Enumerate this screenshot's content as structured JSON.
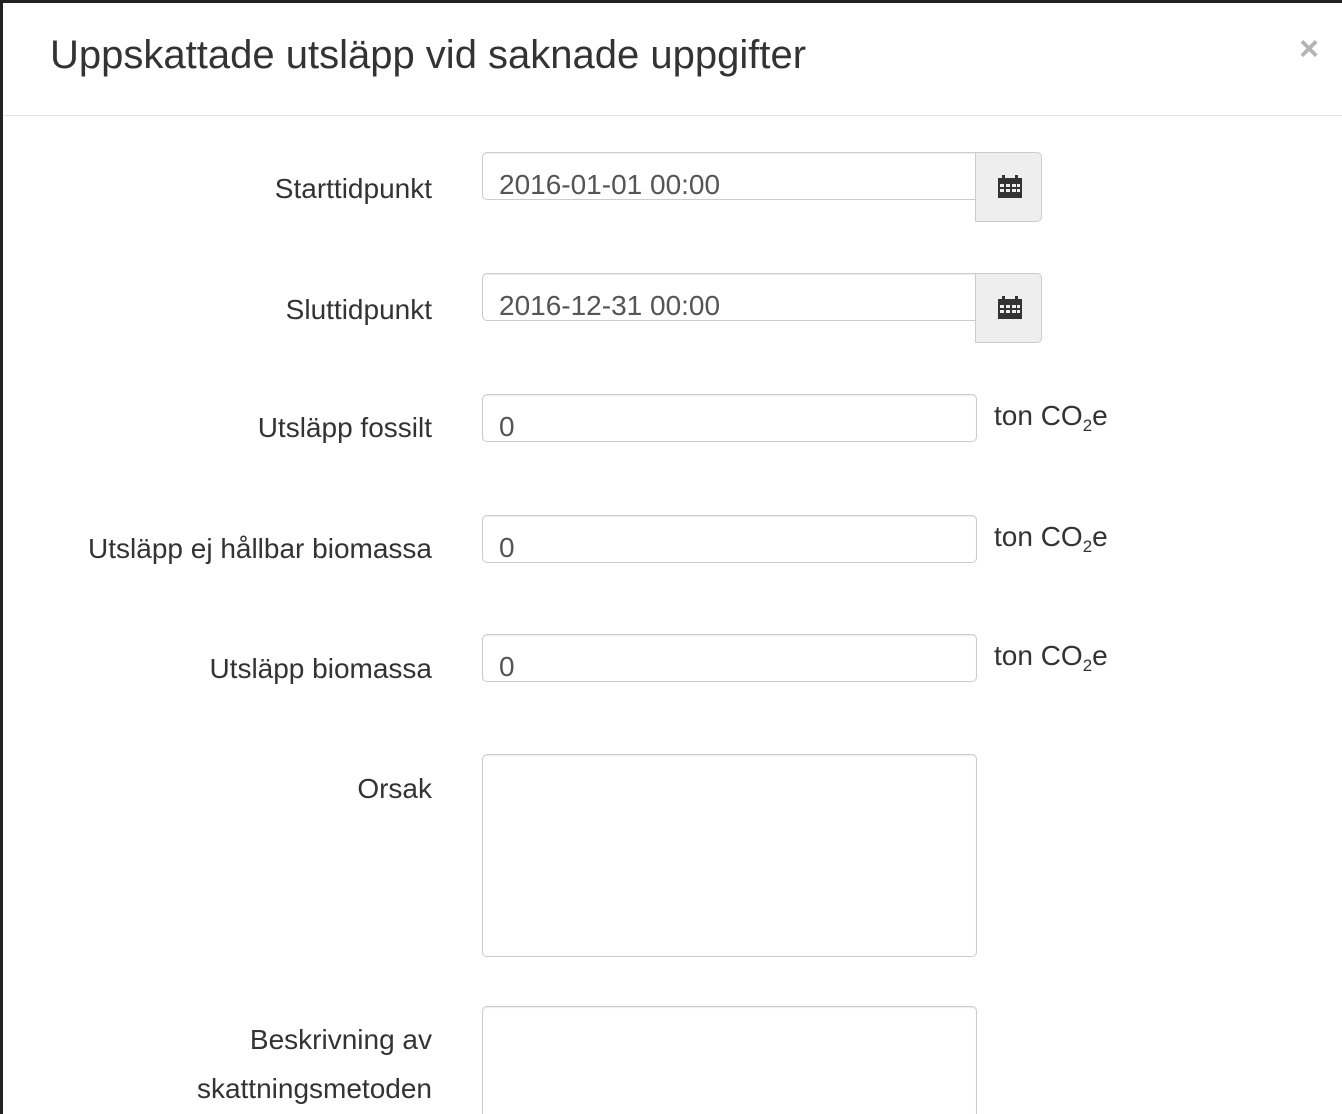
{
  "modal": {
    "title": "Uppskattade utsläpp vid saknade uppgifter",
    "close_glyph": "×"
  },
  "fields": {
    "start": {
      "label": "Starttidpunkt",
      "value": "2016-01-01 00:00",
      "addon_icon": "calendar-icon"
    },
    "end": {
      "label": "Sluttidpunkt",
      "value": "2016-12-31 00:00",
      "addon_icon": "calendar-icon"
    },
    "fossil": {
      "label": "Utsläpp fossilt",
      "value": "0",
      "unit_prefix": "ton CO",
      "unit_sub": "2",
      "unit_suffix": "e"
    },
    "unsustainable_biomass": {
      "label": "Utsläpp ej hållbar biomassa",
      "value": "0",
      "unit_prefix": "ton CO",
      "unit_sub": "2",
      "unit_suffix": "e"
    },
    "biomass": {
      "label": "Utsläpp biomassa",
      "value": "0",
      "unit_prefix": "ton CO",
      "unit_sub": "2",
      "unit_suffix": "e"
    },
    "reason": {
      "label": "Orsak",
      "value": ""
    },
    "method": {
      "label_line1": "Beskrivning av",
      "label_line2": "skattningsmetoden",
      "value": ""
    }
  },
  "colors": {
    "text": "#333333",
    "input_text": "#555555",
    "border": "#cccccc",
    "addon_bg": "#eeeeee",
    "close": "#b3b3b3"
  }
}
